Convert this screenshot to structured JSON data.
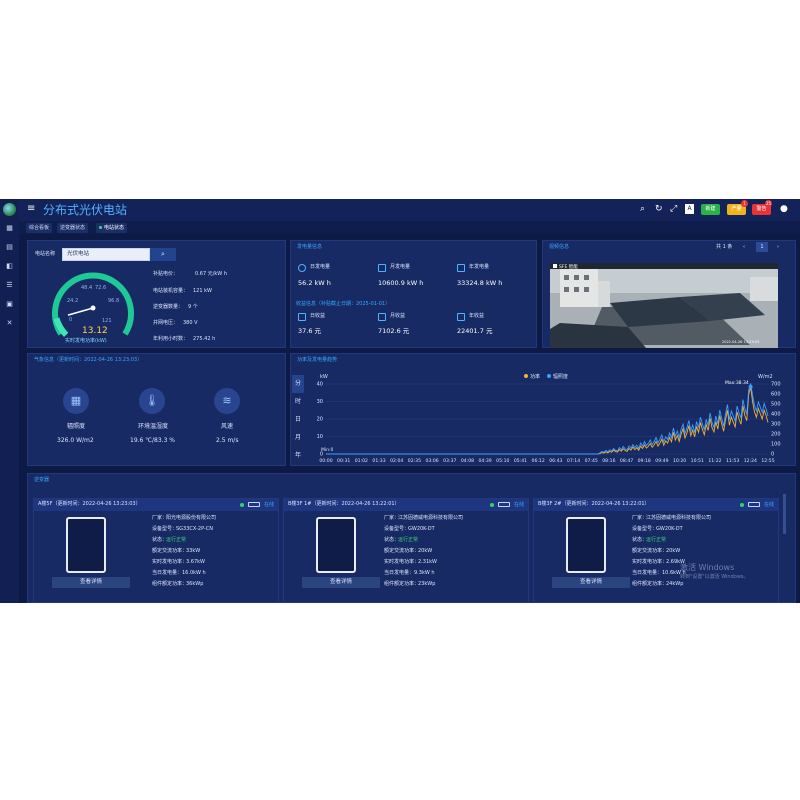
{
  "header": {
    "title": "分布式光伏电站",
    "buttons": {
      "green": "新建",
      "yellow": "产量",
      "red": "警告"
    },
    "badges": {
      "yellow": "1",
      "red": "25"
    }
  },
  "tabs": [
    "综合看板",
    "逆变器状态",
    "电站状态"
  ],
  "station": {
    "name_label": "电站名称",
    "name_value": "光伏电站",
    "gauge": {
      "value": "13.12",
      "label": "实时发电功率(kW)",
      "ticks": [
        "0",
        "24.2",
        "48.4",
        "72.6",
        "96.8",
        "121"
      ],
      "fraction": 0.108
    },
    "info": [
      {
        "label": "补贴电价：",
        "value": "0.67 元/kW h"
      },
      {
        "label": "电站装机容量：",
        "value": "121 kW"
      },
      {
        "label": "逆变器数量：",
        "value": "9 个"
      },
      {
        "label": "并网电压：",
        "value": "380 V"
      },
      {
        "label": "年利用小时数：",
        "value": "275.42 h"
      }
    ]
  },
  "generation": {
    "title": "发电量信息",
    "items": [
      {
        "label": "日发电量",
        "value": "56.2 kW h",
        "icon": "sun-icon"
      },
      {
        "label": "月发电量",
        "value": "10600.9 kW h",
        "icon": "calendar-icon"
      },
      {
        "label": "年发电量",
        "value": "33324.8 kW h",
        "icon": "calendar-year-icon"
      }
    ],
    "revenue_title": "收益信息（补贴截止日期：2025-01-01）",
    "revenue": [
      {
        "label": "日收益",
        "value": "37.6 元"
      },
      {
        "label": "月收益",
        "value": "7102.6 元"
      },
      {
        "label": "年收益",
        "value": "22401.7 元"
      }
    ]
  },
  "video": {
    "title": "视频信息",
    "pager_total": "共 1 条",
    "page": "1",
    "cam_label": "SFE 智能",
    "timestamp": "2022-04-26  13:23:03"
  },
  "weather": {
    "title": "气象信息（更新时间：2022-04-26 13:23:03）",
    "items": [
      {
        "label": "辐照度",
        "value": "326.0 W/m2",
        "icon": "solar-panel-icon"
      },
      {
        "label": "环境温湿度",
        "value": "19.6 ℃/83.3 %",
        "icon": "thermometer-icon"
      },
      {
        "label": "风速",
        "value": "2.5 m/s",
        "icon": "wind-icon"
      }
    ]
  },
  "trend": {
    "title": "功率及发电量趋势",
    "vtabs": [
      "分",
      "时",
      "日",
      "月",
      "年"
    ]
  },
  "chart_data": {
    "type": "line",
    "title": "",
    "legend": [
      "功率",
      "辐照度"
    ],
    "legend_position": "top-center",
    "y_left_label": "kW",
    "y_right_label": "W/m2",
    "y_left_ticks": [
      "0",
      "10",
      "20",
      "30",
      "40"
    ],
    "y_right_ticks": [
      "0",
      "100",
      "200",
      "300",
      "400",
      "500",
      "600",
      "700"
    ],
    "ylim_left": [
      0,
      40
    ],
    "ylim_right": [
      0,
      700
    ],
    "x_ticks": [
      "00:00",
      "00:31",
      "01:02",
      "01:33",
      "02:04",
      "02:35",
      "03:06",
      "03:37",
      "04:08",
      "04:39",
      "05:10",
      "05:41",
      "06:12",
      "06:43",
      "07:14",
      "07:45",
      "08:16",
      "08:47",
      "09:18",
      "09:49",
      "10:20",
      "10:51",
      "11:22",
      "11:53",
      "12:24",
      "12:55"
    ],
    "min_label": "Min:0",
    "max_label": "Max:38.34",
    "series": [
      {
        "name": "功率",
        "color": "#f2b233",
        "values": [
          0,
          0,
          0,
          0,
          0,
          0,
          0,
          0,
          0,
          0,
          0,
          0,
          0,
          0,
          0,
          0,
          0,
          0,
          0,
          0,
          0,
          0,
          0,
          0,
          0,
          0,
          0,
          0,
          0,
          0,
          0,
          0,
          0,
          0,
          0,
          0,
          0,
          0,
          0,
          0,
          0,
          0,
          0,
          0,
          0,
          0,
          0,
          0,
          0,
          0,
          0,
          0,
          0,
          0,
          0,
          0,
          0,
          0,
          0,
          0,
          0,
          0,
          0,
          0,
          0,
          0,
          0,
          0,
          0,
          0,
          0,
          0,
          0,
          0,
          0,
          0,
          0,
          0,
          0,
          0,
          0,
          0,
          0,
          0,
          0,
          0,
          0,
          0,
          0,
          0,
          0,
          0,
          0,
          0,
          0,
          0,
          0,
          0,
          0,
          0,
          0,
          0,
          0,
          0,
          0,
          0,
          0,
          0,
          0,
          0,
          0,
          0,
          0,
          0,
          0,
          0,
          0,
          0,
          0,
          0,
          0,
          0,
          0,
          0,
          0,
          0,
          0,
          0,
          0,
          0,
          0,
          0,
          0,
          0,
          0,
          0,
          0,
          0,
          0,
          0,
          0,
          0,
          0.3,
          0.8,
          0.5,
          1.2,
          0.6,
          1.5,
          1,
          2.2,
          1.4,
          1.1,
          2.5,
          1.6,
          3,
          2,
          1.5,
          3.2,
          2.2,
          4,
          2.5,
          3.6,
          2.1,
          4.5,
          3.2,
          5.2,
          3.4,
          4.4,
          6,
          3.8,
          5.2,
          7.2,
          4.5,
          6.3,
          8.4,
          5,
          7.5,
          6.2,
          9.5,
          7,
          12.4,
          8,
          10.5,
          7.2,
          11.4,
          14.5,
          9.2,
          12,
          16.2,
          10.5,
          13.6,
          9.8,
          15.8,
          12.4,
          18,
          14,
          11,
          16.8,
          13.5,
          20.4,
          15,
          12.6,
          18.5,
          14.2,
          22,
          17.2,
          13,
          19.6,
          25,
          16.4,
          21,
          18.2,
          15.5,
          24,
          20,
          17,
          27.5,
          22,
          19,
          34,
          38.34,
          30,
          24,
          21,
          26,
          23,
          20,
          25,
          22,
          18
        ]
      },
      {
        "name": "辐照度",
        "color": "#3f9dff",
        "values": [
          0,
          0,
          0,
          0,
          0,
          0,
          0,
          0,
          0,
          0,
          0,
          0,
          0,
          0,
          0,
          0,
          0,
          0,
          0,
          0,
          0,
          0,
          0,
          0,
          0,
          0,
          0,
          0,
          0,
          0,
          0,
          0,
          0,
          0,
          0,
          0,
          0,
          0,
          0,
          0,
          0,
          0,
          0,
          0,
          0,
          0,
          0,
          0,
          0,
          0,
          0,
          0,
          0,
          0,
          0,
          0,
          0,
          0,
          0,
          0,
          0,
          0,
          0,
          0,
          0,
          0,
          0,
          0,
          0,
          0,
          0,
          0,
          0,
          0,
          0,
          0,
          0,
          0,
          0,
          0,
          0,
          0,
          0,
          0,
          0,
          0,
          0,
          0,
          0,
          0,
          0,
          0,
          0,
          0,
          0,
          0,
          0,
          0,
          0,
          0,
          0,
          0,
          0,
          0,
          0,
          0,
          0,
          0,
          0,
          0,
          0,
          0,
          0,
          0,
          0,
          0,
          0,
          0,
          0,
          0,
          0,
          0,
          0,
          0,
          0,
          0,
          0,
          0,
          0,
          0,
          0,
          0,
          0,
          0,
          0,
          0,
          0,
          0,
          0,
          0,
          0,
          0,
          12,
          25,
          18,
          35,
          22,
          42,
          30,
          55,
          38,
          32,
          64,
          44,
          75,
          52,
          40,
          80,
          58,
          95,
          64,
          88,
          55,
          110,
          80,
          125,
          85,
          108,
          140,
          95,
          125,
          165,
          112,
          148,
          190,
          122,
          172,
          145,
          210,
          162,
          260,
          180,
          230,
          165,
          248,
          300,
          205,
          262,
          335,
          232,
          290,
          215,
          325,
          265,
          368,
          300,
          240,
          345,
          285,
          410,
          315,
          268,
          380,
          302,
          440,
          358,
          278,
          400,
          495,
          340,
          430,
          378,
          330,
          480,
          410,
          360,
          545,
          452,
          398,
          640,
          705,
          590,
          488,
          430,
          520,
          468,
          415,
          505,
          452,
          380
        ]
      }
    ]
  },
  "inverter": {
    "section_title": "逆变器",
    "status_text": "在线",
    "detail_button": "查看详情",
    "cards": [
      {
        "title": "A楼5F（更新时间：2022-04-26 13:23:03）",
        "fields": [
          {
            "label": "厂家：",
            "value": "阳光电源股份有限公司"
          },
          {
            "label": "设备型号：",
            "value": "SG33CX-2P-CN"
          },
          {
            "label": "状态：",
            "value": "运行正常"
          },
          {
            "label": "额定交流功率：",
            "value": "33kW"
          },
          {
            "label": "实时发电功率：",
            "value": "3.67kW"
          },
          {
            "label": "当日发电量：",
            "value": "16.0kW h"
          },
          {
            "label": "组件额定功率：",
            "value": "36kWp"
          }
        ]
      },
      {
        "title": "B楼3F 1#（更新时间：2022-04-26 13:22:01）",
        "fields": [
          {
            "label": "厂家：",
            "value": "江苏固德威电源科技有限公司"
          },
          {
            "label": "设备型号：",
            "value": "GW20K-DT"
          },
          {
            "label": "状态：",
            "value": "运行正常"
          },
          {
            "label": "额定交流功率：",
            "value": "20kW"
          },
          {
            "label": "实时发电功率：",
            "value": "2.31kW"
          },
          {
            "label": "当日发电量：",
            "value": "9.3kW h"
          },
          {
            "label": "组件额定功率：",
            "value": "23kWp"
          }
        ]
      },
      {
        "title": "B楼3F 2#（更新时间：2022-04-26 13:22:01）",
        "fields": [
          {
            "label": "厂家：",
            "value": "江苏固德威电源科技有限公司"
          },
          {
            "label": "设备型号：",
            "value": "GW20K-DT"
          },
          {
            "label": "状态：",
            "value": "运行正常"
          },
          {
            "label": "额定交流功率：",
            "value": "20kW"
          },
          {
            "label": "实时发电功率：",
            "value": "2.69kW"
          },
          {
            "label": "当日发电量：",
            "value": "10.6kW h"
          },
          {
            "label": "组件额定功率：",
            "value": "24kWp"
          }
        ]
      }
    ]
  },
  "watermark": {
    "line1": "激活 Windows",
    "line2": "转到\"设置\"以激活 Windows。"
  }
}
